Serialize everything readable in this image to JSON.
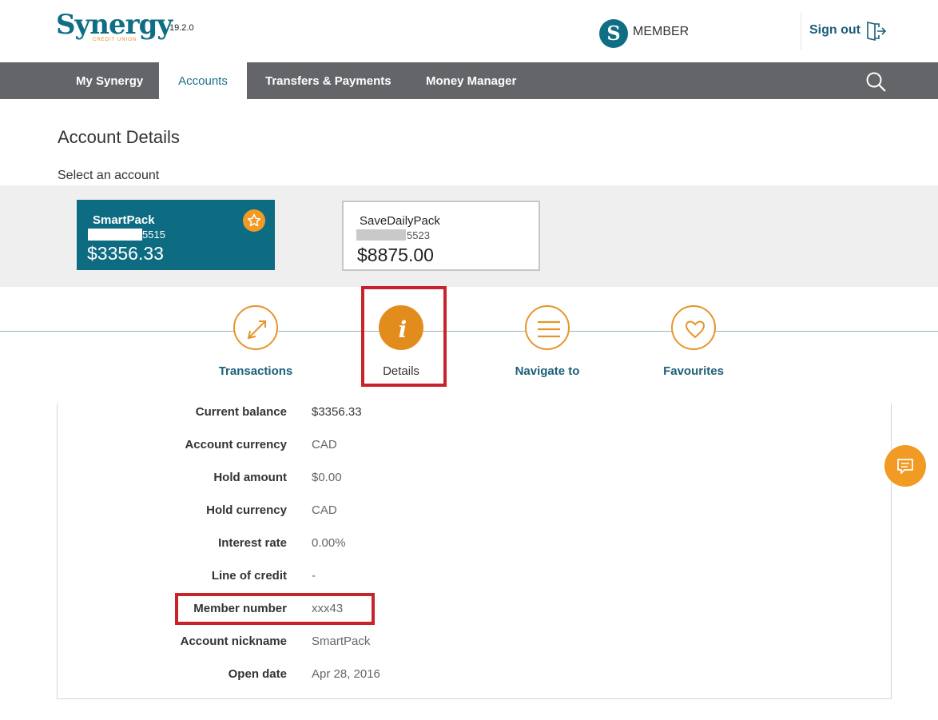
{
  "header": {
    "logo_word": "Synergy",
    "logo_sub": "CREDIT UNION",
    "version": "19.2.0",
    "member_initial": "S",
    "member_label": "MEMBER",
    "signout_label": "Sign out"
  },
  "nav": {
    "items": [
      {
        "label": "My Synergy"
      },
      {
        "label": "Accounts"
      },
      {
        "label": "Transfers & Payments"
      },
      {
        "label": "Money Manager"
      }
    ],
    "active": "Accounts"
  },
  "page": {
    "title": "Account Details",
    "select_label": "Select an account"
  },
  "accounts": [
    {
      "name": "SmartPack",
      "number_suffix": "5515",
      "balance": "$3356.33",
      "selected": true,
      "favourite": true
    },
    {
      "name": "SaveDailyPack",
      "number_suffix": "5523",
      "balance": "$8875.00",
      "selected": false
    }
  ],
  "actions": [
    {
      "label": "Transactions",
      "icon": "transfer-arrows-icon"
    },
    {
      "label": "Details",
      "icon": "info-icon",
      "active": true
    },
    {
      "label": "Navigate to",
      "icon": "menu-lines-icon"
    },
    {
      "label": "Favourites",
      "icon": "heart-icon"
    }
  ],
  "details": [
    {
      "label": "Current balance",
      "value": "$3356.33"
    },
    {
      "label": "Account currency",
      "value": "CAD"
    },
    {
      "label": "Hold amount",
      "value": "$0.00"
    },
    {
      "label": "Hold currency",
      "value": "CAD"
    },
    {
      "label": "Interest rate",
      "value": "0.00%"
    },
    {
      "label": "Line of credit",
      "value": "-"
    },
    {
      "label": "Member number",
      "value": "xxx43"
    },
    {
      "label": "Account nickname",
      "value": "SmartPack"
    },
    {
      "label": "Open date",
      "value": "Apr 28, 2016"
    }
  ],
  "colors": {
    "brand_teal": "#0f6e84",
    "accent_orange": "#e38c1e",
    "nav_grey": "#636569",
    "highlight_red": "#c8232a"
  }
}
